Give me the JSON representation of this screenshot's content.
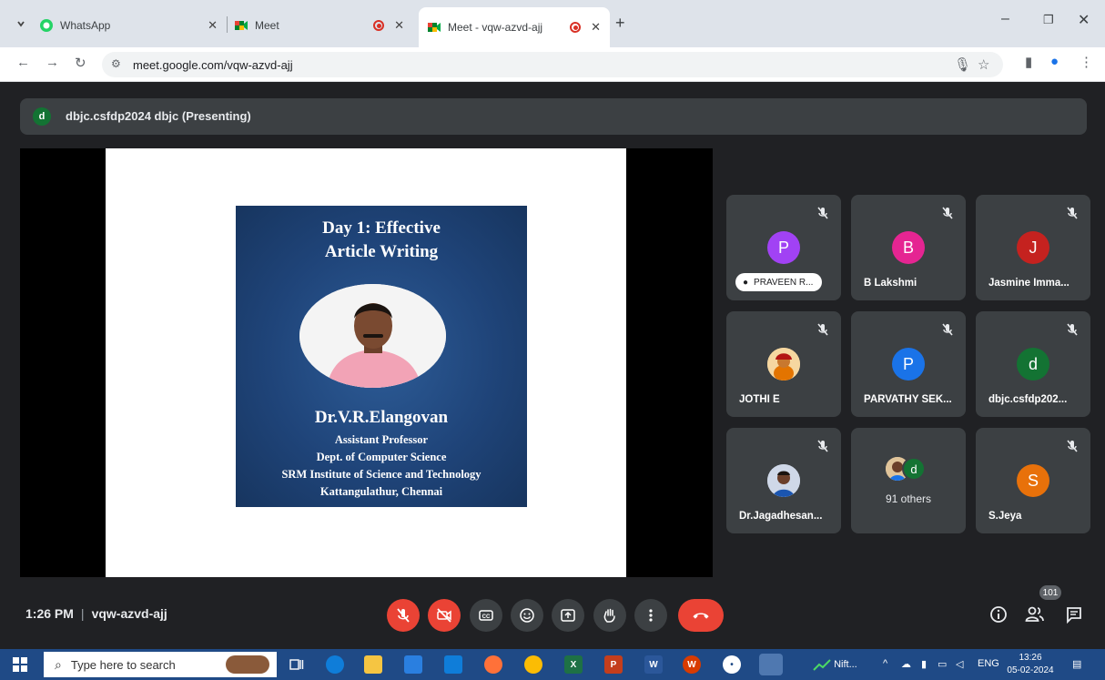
{
  "browser": {
    "tabs": [
      {
        "title": "WhatsApp",
        "active": false,
        "recording": false
      },
      {
        "title": "Meet",
        "active": false,
        "recording": true
      },
      {
        "title": "Meet - vqw-azvd-ajj",
        "active": true,
        "recording": true
      }
    ],
    "url": "meet.google.com/vqw-azvd-ajj",
    "colors": {
      "tabbar": "#dee3ea",
      "meet_bg": "#202124",
      "tile_bg": "#3c4043",
      "danger": "#ea4335"
    }
  },
  "meet": {
    "presenter_avatar": "d",
    "presenting_label": "dbjc.csfdp2024 dbjc (Presenting)",
    "slide": {
      "title_line1": "Day 1:  Effective",
      "title_line2": "Article Writing",
      "name": "Dr.V.R.Elangovan",
      "line1": "Assistant Professor",
      "line2": "Dept. of Computer Science",
      "line3": "SRM Institute of Science and Technology",
      "line4": "Kattangulathur, Chennai"
    },
    "participants": [
      {
        "initial": "P",
        "name": "PRAVEEN R...",
        "color": "#a142f4",
        "pinned": true
      },
      {
        "initial": "B",
        "name": "B Lakshmi",
        "color": "#e52592"
      },
      {
        "initial": "J",
        "name": "Jasmine Imma...",
        "color": "#c5221f"
      },
      {
        "initial": "",
        "name": "JOTHI E",
        "color": "#e37400",
        "photo": true
      },
      {
        "initial": "P",
        "name": "PARVATHY SEK...",
        "color": "#1a73e8"
      },
      {
        "initial": "d",
        "name": "dbjc.csfdp202...",
        "color": "#137333"
      },
      {
        "initial": "",
        "name": "Dr.Jagadhesan...",
        "color": "#1a73e8",
        "photo": true
      },
      {
        "others_initial": "d",
        "others_label": "91 others"
      },
      {
        "initial": "S",
        "name": "S.Jeya",
        "color": "#e8710a"
      }
    ],
    "time": "1:26 PM",
    "meeting_code": "vqw-azvd-ajj",
    "people_count": "101",
    "icons": [
      "mic-off-icon",
      "camera-off-icon",
      "captions-icon",
      "emoji-icon",
      "present-icon",
      "raise-hand-icon",
      "more-options-icon",
      "hang-up-icon",
      "info-icon",
      "people-icon",
      "chat-icon"
    ]
  },
  "taskbar": {
    "search_placeholder": "Type here to search",
    "nifty_label": "Nift...",
    "language": "ENG",
    "time": "13:26",
    "date": "05-02-2024"
  }
}
